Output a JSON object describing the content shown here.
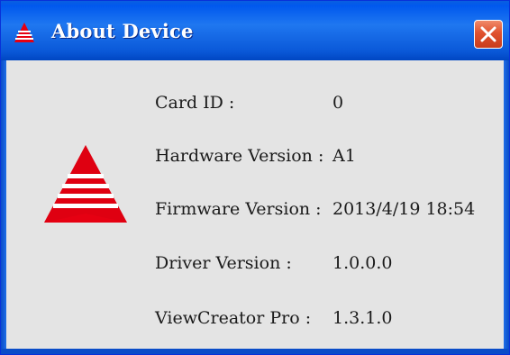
{
  "window": {
    "title": "About Device",
    "close_icon": "close-icon",
    "app_icon": "triangle-logo-icon"
  },
  "colors": {
    "titlebar": "#0a58d8",
    "client_background": "#e4e4e4",
    "close_button": "#e0522e",
    "logo_red": "#e60012"
  },
  "device_logo": "triangle-logo-icon",
  "info": [
    {
      "label": "Card ID :",
      "value": "0"
    },
    {
      "label": "Hardware Version :",
      "value": "A1"
    },
    {
      "label": "Firmware Version :",
      "value": "2013/4/19 18:54"
    },
    {
      "label": "Driver Version :",
      "value": "1.0.0.0"
    },
    {
      "label": "ViewCreator Pro :",
      "value": "1.3.1.0"
    }
  ]
}
